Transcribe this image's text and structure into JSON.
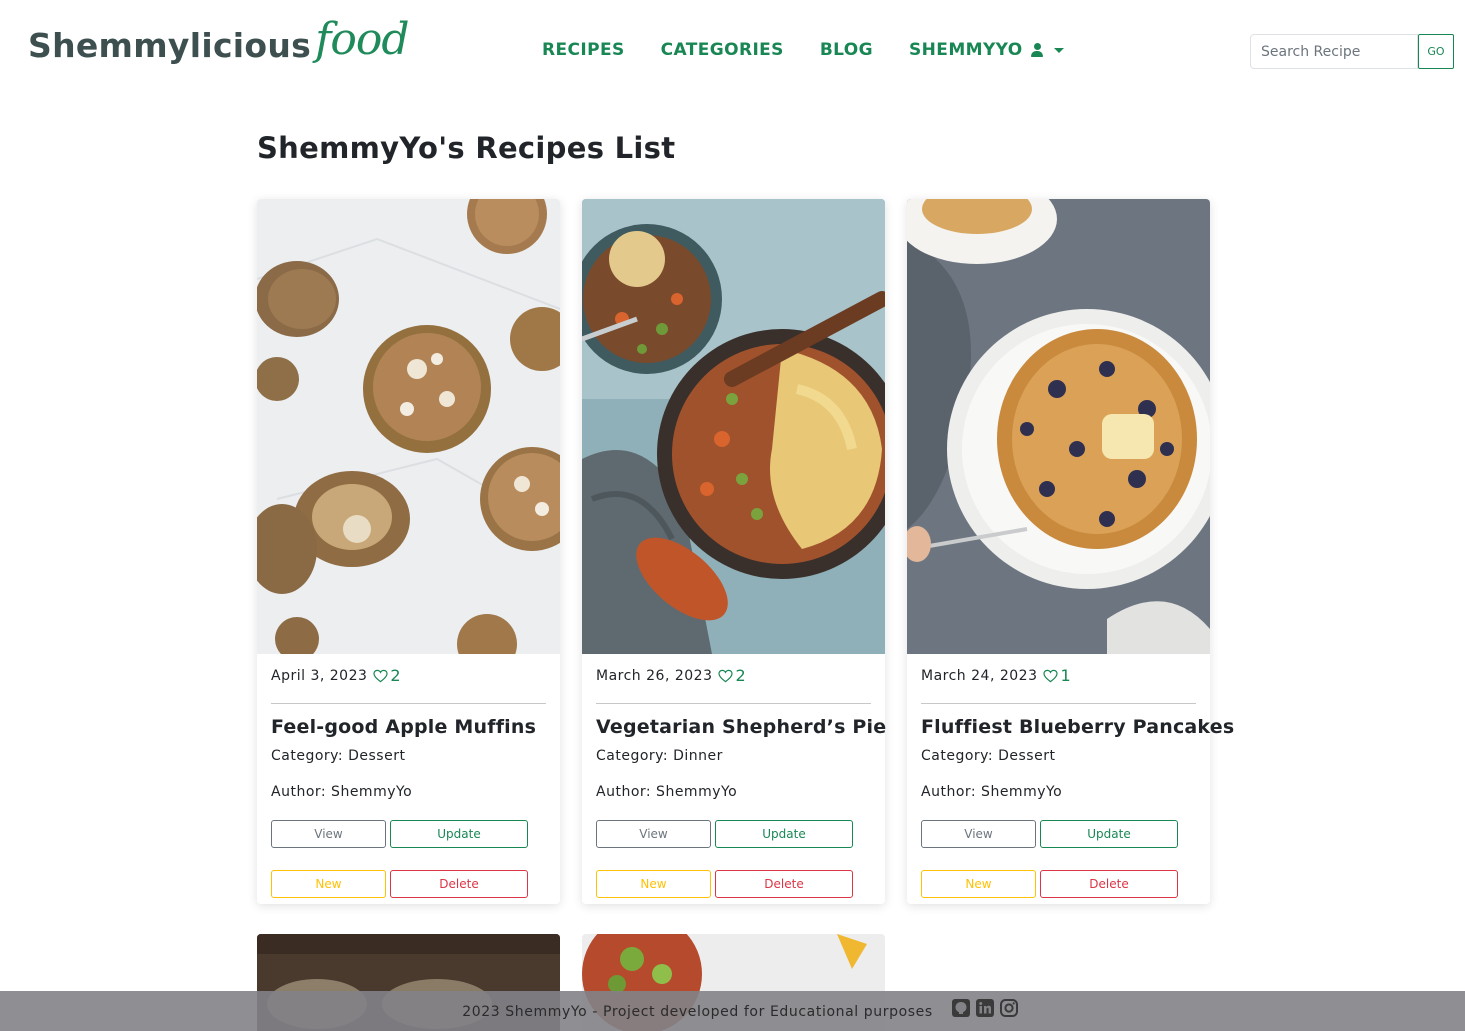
{
  "brand": {
    "main": "Shemmylicious",
    "script": "food"
  },
  "nav": {
    "items": [
      {
        "label": "RECIPES"
      },
      {
        "label": "CATEGORIES"
      },
      {
        "label": "BLOG"
      },
      {
        "label": "SHEMMYYO"
      }
    ],
    "user_icon": "user-icon",
    "dropdown_icon": "caret-down-icon"
  },
  "search": {
    "placeholder": "Search Recipe",
    "value": "",
    "button_label": "GO"
  },
  "page": {
    "title": "ShemmyYo's Recipes List"
  },
  "cards": [
    {
      "date": "April 3, 2023",
      "likes": "2",
      "title": "Feel-good Apple Muffins",
      "category": "Category: Dessert",
      "author": "Author: ShemmyYo"
    },
    {
      "date": "March 26, 2023",
      "likes": "2",
      "title": "Vegetarian Shepherd’s Pie",
      "category": "Category: Dinner",
      "author": "Author: ShemmyYo"
    },
    {
      "date": "March 24, 2023",
      "likes": "1",
      "title": "Fluffiest Blueberry Pancakes",
      "category": "Category: Dessert",
      "author": "Author: ShemmyYo"
    }
  ],
  "buttons": {
    "view": "View",
    "update": "Update",
    "new": "New",
    "delete": "Delete"
  },
  "footer": {
    "text": "2023 ShemmyYo - Project developed for Educational purposes",
    "icons": [
      "github-icon",
      "linkedin-icon",
      "instagram-icon"
    ]
  },
  "colors": {
    "brand_green": "#198754",
    "brand_dark": "#3d4f4f",
    "warning": "#ffc107",
    "danger": "#dc3545",
    "secondary": "#6c757d"
  }
}
